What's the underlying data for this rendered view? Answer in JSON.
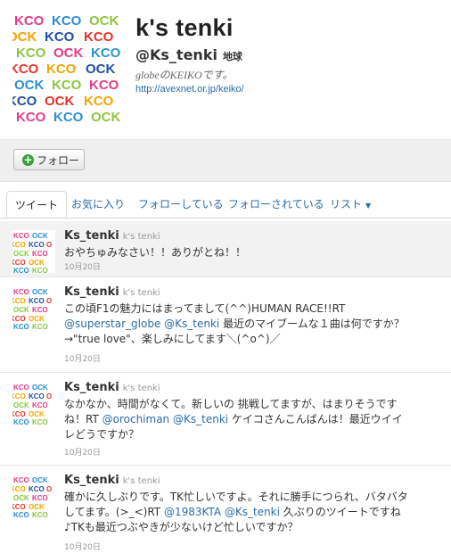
{
  "profile": {
    "name": "k's tenki",
    "handle": "@Ks_tenki",
    "location": "地球",
    "bio": "globeのKEIKOです。",
    "url": "http://avexnet.or.jp/keiko/"
  },
  "actions": {
    "follow_label": "フォロー"
  },
  "tabs": [
    {
      "label": "ツイート"
    },
    {
      "label": "お気に入り"
    },
    {
      "label": "フォローしている"
    },
    {
      "label": "フォローされている"
    },
    {
      "label": "リスト"
    }
  ],
  "tweets": [
    {
      "screen_name": "Ks_tenki",
      "full_name": "k's tenki",
      "text": "おやちゅみなさい！！ありがとね！！",
      "time": "10月20日"
    },
    {
      "screen_name": "Ks_tenki",
      "full_name": "k's tenki",
      "text_a": "この頃F1の魅力にはまってまして(^^)HUMAN RACE!!RT",
      "mention_a": "@superstar_globe",
      "mention_b": "@Ks_tenki",
      "text_b": "最近のマイブームな１曲は何ですか？",
      "text_c": "→\"true love\"、楽しみにしてます＼(^o^)／",
      "time": "10月20日"
    },
    {
      "screen_name": "Ks_tenki",
      "full_name": "k's tenki",
      "text_a": "なかなか、時間がなくて。新しいの 挑戦してますが、はまりそうです",
      "text_b": "ね！RT",
      "mention_a": "@orochiman",
      "mention_b": "@Ks_tenki",
      "text_c": "ケイコさんこんばんは！最近ウイイ",
      "text_d": "レどうですか？",
      "time": "10月20日"
    },
    {
      "screen_name": "Ks_tenki",
      "full_name": "k's tenki",
      "text_a": "確かに久しぶりです。TK忙しいですよ。それに勝手につられ、バタバタ",
      "text_b": "してます。(>_<)RT",
      "mention_a": "@1983KTA",
      "mention_b": "@Ks_tenki",
      "text_c": "久ぶりのツイートですね",
      "text_d": "♪TKも最近つぶやきが少ないけど忙しいですか？",
      "time": "10月20日"
    }
  ],
  "colors": {
    "link": "#2a6da7",
    "highlight_bg": "#f2f2f2",
    "action_bar_bg": "#efefef"
  }
}
